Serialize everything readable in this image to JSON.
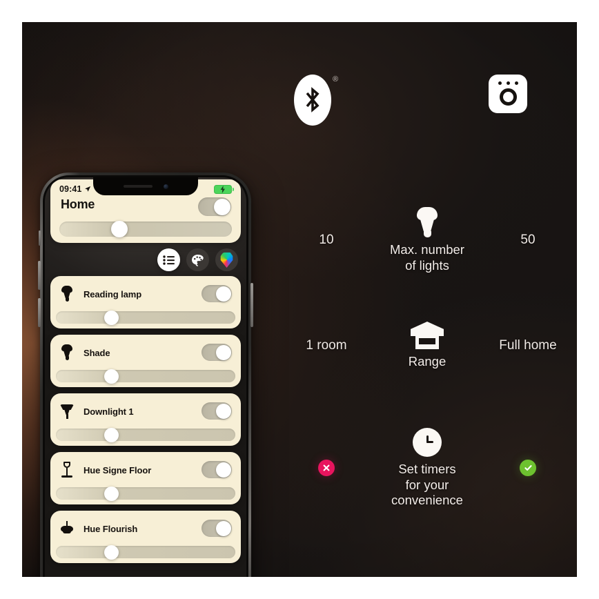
{
  "scene": {
    "background_dark": "#171413",
    "glow_color": "#c4784a"
  },
  "badges": {
    "bluetooth": {
      "icon": "bluetooth-icon",
      "registered_mark": "®"
    },
    "bridge": {
      "icon": "hue-bridge-icon"
    }
  },
  "comparisons": [
    {
      "id": "max-lights",
      "left_value": "10",
      "right_value": "50",
      "caption": "Max. number\nof lights",
      "caption_line1": "Max. number",
      "caption_line2": "of lights",
      "icon": "light-bulb-icon"
    },
    {
      "id": "range",
      "left_value": "1 room",
      "right_value": "Full home",
      "caption": "Range",
      "caption_line1": "Range",
      "caption_line2": "",
      "icon": "house-icon"
    },
    {
      "id": "timers",
      "left_value": "✕",
      "right_value": "✓",
      "caption": "Set timers\nfor your\nconvenience",
      "caption_line1": "Set timers",
      "caption_line2": "for your",
      "caption_line3": "convenience",
      "icon": "clock-icon",
      "left_state_color": "#e8145e",
      "right_state_color": "#6dc22f"
    }
  ],
  "phone": {
    "status_bar": {
      "time": "09:41",
      "location_icon": "location-arrow-icon",
      "battery_icon": "battery-charging-icon",
      "battery_color": "#4cd55b"
    },
    "header": {
      "title": "Home",
      "master_toggle_state": "on",
      "brightness_percent": 30
    },
    "mode_buttons": [
      {
        "id": "list",
        "icon": "list-icon",
        "active": true
      },
      {
        "id": "scenes",
        "icon": "palette-icon",
        "active": false
      },
      {
        "id": "color",
        "icon": "color-picker-icon",
        "active": false
      }
    ],
    "card_color": "#f7efd6",
    "lights": [
      {
        "name": "Reading lamp",
        "icon": "bulb-icon",
        "toggle_state": "on",
        "brightness_percent": 27
      },
      {
        "name": "Shade",
        "icon": "bulb-icon",
        "toggle_state": "on",
        "brightness_percent": 27
      },
      {
        "name": "Downlight 1",
        "icon": "downlight-icon",
        "toggle_state": "on",
        "brightness_percent": 27
      },
      {
        "name": "Hue Signe Floor",
        "icon": "floor-lamp-icon",
        "toggle_state": "on",
        "brightness_percent": 27
      },
      {
        "name": "Hue Flourish",
        "icon": "pendant-lamp-icon",
        "toggle_state": "on",
        "brightness_percent": 27
      }
    ]
  }
}
